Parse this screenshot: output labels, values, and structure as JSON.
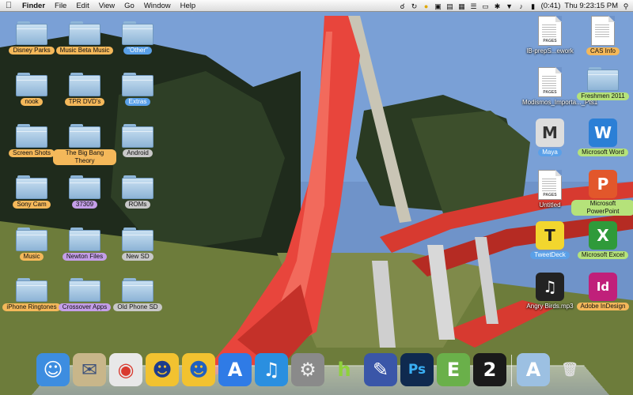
{
  "menubar": {
    "apple_icon": "apple-icon",
    "items": [
      "Finder",
      "File",
      "Edit",
      "View",
      "Go",
      "Window",
      "Help"
    ],
    "battery": "(0:41)",
    "clock": "Thu 9:23:15 PM",
    "status_icons": [
      "headphones-icon",
      "sync-icon",
      "ball-icon",
      "lock-icon",
      "document-icon",
      "grid-icon",
      "menu-icon",
      "display-icon",
      "bluetooth-icon",
      "wifi-icon",
      "volume-icon",
      "battery-icon",
      "search-icon"
    ]
  },
  "desktop": {
    "left_icons": [
      {
        "label": "Disney Parks",
        "color": "orange"
      },
      {
        "label": "Music Beta Music",
        "color": "orange"
      },
      {
        "label": "\"Other\"",
        "color": "blue"
      },
      {
        "label": "nook",
        "color": "orange"
      },
      {
        "label": "TPR DVD's",
        "color": "orange"
      },
      {
        "label": "Extras",
        "color": "blue"
      },
      {
        "label": "Screen Shots",
        "color": "orange"
      },
      {
        "label": "The Big Bang Theory",
        "color": "orange"
      },
      {
        "label": "Android",
        "color": "gray"
      },
      {
        "label": "Sony Cam",
        "color": "orange"
      },
      {
        "label": "37309",
        "color": "purple"
      },
      {
        "label": "ROMs",
        "color": "gray"
      },
      {
        "label": "Music",
        "color": "orange"
      },
      {
        "label": "Newton Files",
        "color": "purple"
      },
      {
        "label": "New SD",
        "color": "gray"
      },
      {
        "label": "iPhone Ringtones",
        "color": "orange"
      },
      {
        "label": "Crossover Apps",
        "color": "purple"
      },
      {
        "label": "Old Phone SD",
        "color": "gray"
      }
    ],
    "right_icons": [
      {
        "label": "IB-prepS...ework",
        "type": "doc",
        "kind": "PAGES",
        "color": "plain"
      },
      {
        "label": "CAS Info",
        "type": "doc",
        "kind": "",
        "color": "orange"
      },
      {
        "label": "Modismos_Importa..._Pts1",
        "type": "doc",
        "kind": "PAGES",
        "color": "plain"
      },
      {
        "label": "Freshmen 2011",
        "type": "folder",
        "color": "green"
      },
      {
        "label": "Maya",
        "type": "app",
        "glyph": "M",
        "color": "blue"
      },
      {
        "label": "Microsoft Word",
        "type": "app",
        "glyph": "W",
        "color": "green"
      },
      {
        "label": "Untitled",
        "type": "doc",
        "kind": "PAGES",
        "color": "plain"
      },
      {
        "label": "Microsoft PowerPoint",
        "type": "app",
        "glyph": "P",
        "color": "green"
      },
      {
        "label": "TweetDeck",
        "type": "app",
        "glyph": "T",
        "color": "blue"
      },
      {
        "label": "Microsoft Excel",
        "type": "app",
        "glyph": "X",
        "color": "green"
      },
      {
        "label": "Angry Birds.mp3",
        "type": "app",
        "glyph": "♫",
        "color": "plain"
      },
      {
        "label": "Adobe InDesign",
        "type": "app",
        "glyph": "Id",
        "color": "orange"
      }
    ]
  },
  "dock": {
    "apps": [
      {
        "name": "finder-icon",
        "glyph": "☺",
        "bg": "#3d8de0",
        "fg": "#fff"
      },
      {
        "name": "mail-icon",
        "glyph": "✉",
        "bg": "#c8b68a",
        "fg": "#3a4f7a"
      },
      {
        "name": "chrome-icon",
        "glyph": "◉",
        "bg": "#e8e8e8",
        "fg": "#d93a2f"
      },
      {
        "name": "cyberduck-icon",
        "glyph": "☻",
        "bg": "#f2c230",
        "fg": "#1d3c8c"
      },
      {
        "name": "transmission-icon",
        "glyph": "☻",
        "bg": "#f2c230",
        "fg": "#2060c0"
      },
      {
        "name": "app-store-icon",
        "glyph": "A",
        "bg": "#2f7be6",
        "fg": "#fff"
      },
      {
        "name": "itunes-icon",
        "glyph": "♫",
        "bg": "#2a8fe0",
        "fg": "#fff"
      },
      {
        "name": "system-preferences-icon",
        "glyph": "⚙",
        "bg": "#8a8a8a",
        "fg": "#eee"
      },
      {
        "name": "hulu-icon",
        "glyph": "h",
        "bg": "transparent",
        "fg": "#8fd13c"
      },
      {
        "name": "quill-icon",
        "glyph": "✎",
        "bg": "#3a56a8",
        "fg": "#fff"
      },
      {
        "name": "photoshop-icon",
        "glyph": "Ps",
        "bg": "#0f2a4f",
        "fg": "#3ab0f5"
      },
      {
        "name": "evernote-icon",
        "glyph": "E",
        "bg": "#6ab04a",
        "fg": "#fff"
      },
      {
        "name": "portal-2-icon",
        "glyph": "2",
        "bg": "#1a1a1a",
        "fg": "#fff"
      },
      {
        "name": "applications-folder-icon",
        "glyph": "A",
        "bg": "#9cc0e2",
        "fg": "#fff"
      },
      {
        "name": "trash-icon",
        "glyph": "🗑",
        "bg": "transparent",
        "fg": "#ddd"
      }
    ]
  }
}
